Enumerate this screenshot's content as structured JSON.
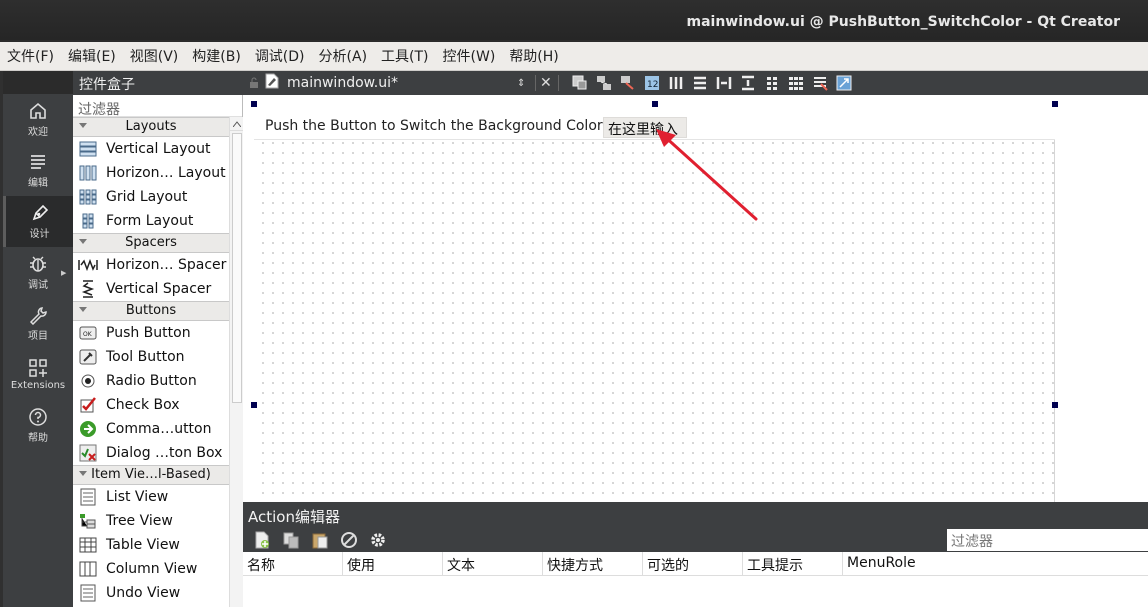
{
  "window": {
    "title": "mainwindow.ui @ PushButton_SwitchColor - Qt Creator"
  },
  "menubar": {
    "items": [
      "文件(F)",
      "编辑(E)",
      "视图(V)",
      "构建(B)",
      "调试(D)",
      "分析(A)",
      "工具(T)",
      "控件(W)",
      "帮助(H)"
    ]
  },
  "modes": [
    {
      "label": "欢迎",
      "icon": "home-icon"
    },
    {
      "label": "编辑",
      "icon": "edit-lines-icon"
    },
    {
      "label": "设计",
      "icon": "pen-icon",
      "active": true
    },
    {
      "label": "调试",
      "icon": "bug-icon"
    },
    {
      "label": "项目",
      "icon": "wrench-icon"
    },
    {
      "label": "Extensions",
      "icon": "extensions-icon"
    },
    {
      "label": "帮助",
      "icon": "help-icon"
    }
  ],
  "widgetbox": {
    "title": "控件盒子",
    "filter_placeholder": "过滤器",
    "categories": [
      {
        "name": "Layouts",
        "items": [
          "Vertical Layout",
          "Horizon… Layout",
          "Grid Layout",
          "Form Layout"
        ]
      },
      {
        "name": "Spacers",
        "items": [
          "Horizon… Spacer",
          "Vertical Spacer"
        ]
      },
      {
        "name": "Buttons",
        "items": [
          "Push Button",
          "Tool Button",
          "Radio Button",
          "Check Box",
          "Comma…utton",
          "Dialog …ton Box"
        ]
      },
      {
        "name": "Item Vie…l-Based)",
        "items": [
          "List View",
          "Tree View",
          "Table View",
          "Column View",
          "Undo View"
        ]
      }
    ]
  },
  "document": {
    "filename": "mainwindow.ui*"
  },
  "form": {
    "label_text": "Push the Button to Switch the Background Color",
    "lineedit_text": "在这里输入"
  },
  "action_editor": {
    "title": "Action编辑器",
    "filter_placeholder": "过滤器",
    "columns": [
      "名称",
      "使用",
      "文本",
      "快捷方式",
      "可选的",
      "工具提示",
      "MenuRole"
    ]
  },
  "colors": {
    "annotation_arrow": "#e02030",
    "dark_panel": "#3d3f41",
    "handle": "#000050"
  }
}
